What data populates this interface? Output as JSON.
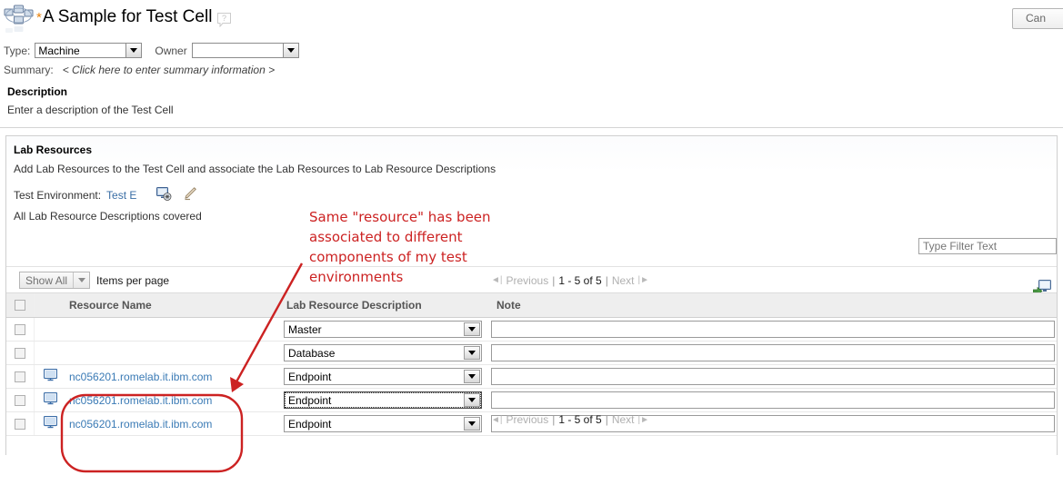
{
  "header": {
    "icon": "network-cluster-icon",
    "modified_marker": "*",
    "title": "A Sample for Test Cell",
    "help_icon": "help-bubble-icon",
    "cancel_label": "Can"
  },
  "form": {
    "type_label": "Type:",
    "type_value": "Machine",
    "owner_label": "Owner",
    "owner_value": "",
    "summary_label": "Summary:",
    "summary_hint": "< Click here to enter summary information >"
  },
  "description": {
    "heading": "Description",
    "text": "Enter a description of the Test Cell"
  },
  "lab_resources": {
    "heading": "Lab Resources",
    "subtext": "Add Lab Resources to the Test Cell and associate the Lab Resources to Lab Resource Descriptions",
    "test_env_label": "Test Environment:",
    "test_env_value": "Test E",
    "select_icon": "select-test-environment-icon",
    "edit_icon": "edit-pencil-icon",
    "covered_text": "All Lab Resource Descriptions covered",
    "filter_placeholder": "Type Filter Text",
    "filter_value": "",
    "add_resource_icon": "add-resource-monitor-icon"
  },
  "pager": {
    "show_all_label": "Show All",
    "items_per_page_label": "Items per page",
    "first_icon": "first-page-icon",
    "previous_label": "Previous",
    "separator": "|",
    "range_label": "1 - 5 of 5",
    "next_label": "Next",
    "last_icon": "last-page-icon"
  },
  "table": {
    "columns": [
      "Resource Name",
      "Lab Resource Description",
      "Note"
    ],
    "rows": [
      {
        "checked": false,
        "has_machine_icon": false,
        "resource_name": "",
        "description": "Master",
        "note": "",
        "focused": false
      },
      {
        "checked": false,
        "has_machine_icon": false,
        "resource_name": "",
        "description": "Database",
        "note": "",
        "focused": false
      },
      {
        "checked": false,
        "has_machine_icon": true,
        "resource_name": "nc056201.romelab.it.ibm.com",
        "description": "Endpoint",
        "note": "",
        "focused": false
      },
      {
        "checked": false,
        "has_machine_icon": true,
        "resource_name": "nc056201.romelab.it.ibm.com",
        "description": "Endpoint",
        "note": "",
        "focused": true
      },
      {
        "checked": false,
        "has_machine_icon": true,
        "resource_name": "nc056201.romelab.it.ibm.com",
        "description": "Endpoint",
        "note": "",
        "focused": false
      }
    ]
  },
  "annotation": {
    "text": "Same \"resource\" has been associated to different components of my test environments",
    "color": "#cc2222",
    "shape": "arrow-and-rounded-highlight"
  }
}
